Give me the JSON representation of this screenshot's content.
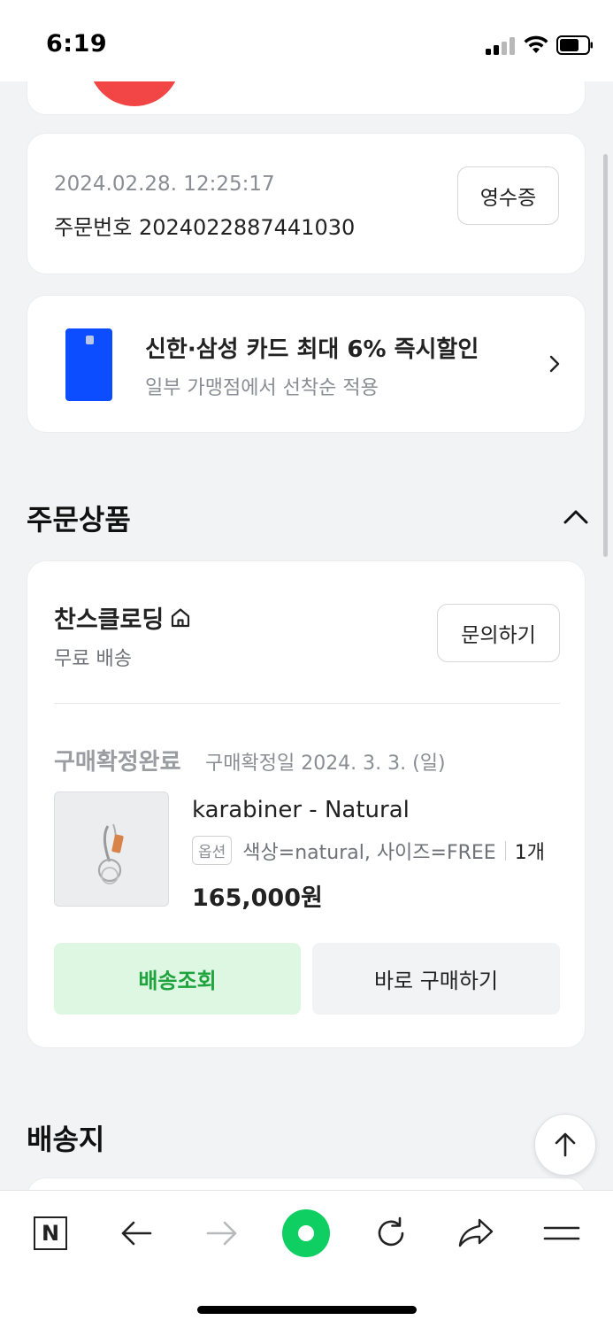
{
  "status_bar": {
    "time": "6:19"
  },
  "order": {
    "datetime": "2024.02.28. 12:25:17",
    "number": "주문번호 2024022887441030",
    "receipt_label": "영수증"
  },
  "promo": {
    "title": "신한·삼성 카드 최대 6% 즉시할인",
    "subtitle": "일부 가맹점에서 선착순 적용"
  },
  "sections": {
    "ordered_products": "주문상품",
    "shipping_address": "배송지"
  },
  "product_card": {
    "seller": "찬스클로딩",
    "shipping_fee": "무료 배송",
    "inquiry_label": "문의하기",
    "status": "구매확정완료",
    "confirm_date": "구매확정일 2024. 3. 3. (일)",
    "item": {
      "name": "karabiner - Natural",
      "option_badge": "옵션",
      "option": "색상=natural, 사이즈=FREE",
      "quantity": "1개",
      "price": "165,000원"
    },
    "track_label": "배송조회",
    "buy_again_label": "바로 구매하기"
  },
  "colors": {
    "accent_green": "#1fa33d",
    "track_bg": "#ddf7e3",
    "card_blue": "#0b4dff",
    "brand_green": "#0fcf63",
    "red": "#f24646"
  },
  "toolbar": {
    "n_logo": "N",
    "icons": [
      "naver-n-icon",
      "back-arrow-icon",
      "forward-arrow-icon",
      "green-dot-icon",
      "refresh-icon",
      "share-icon",
      "menu-icon"
    ]
  }
}
